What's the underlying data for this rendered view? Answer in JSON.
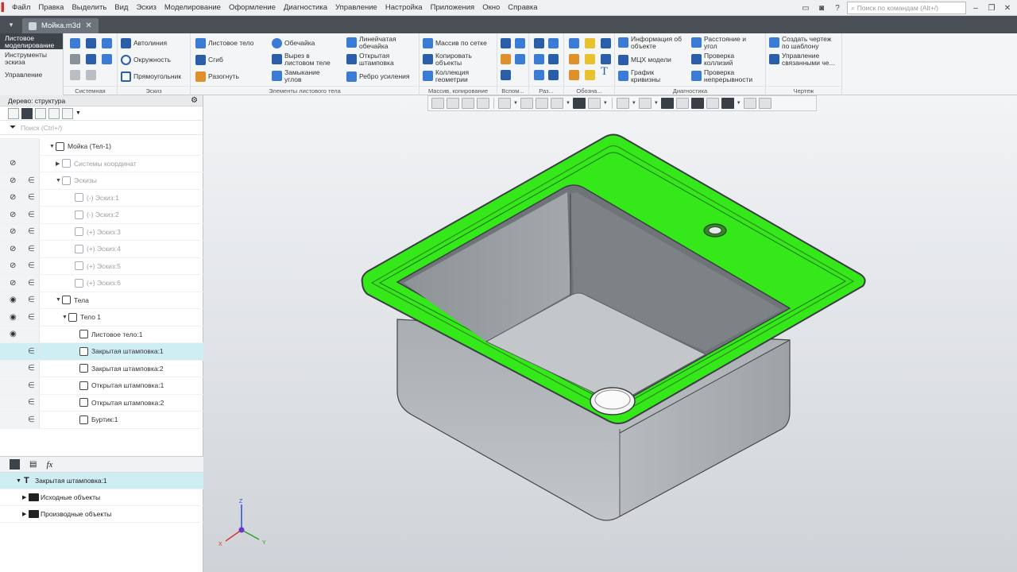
{
  "menu": [
    "Файл",
    "Правка",
    "Выделить",
    "Вид",
    "Эскиз",
    "Моделирование",
    "Оформление",
    "Диагностика",
    "Управление",
    "Настройка",
    "Приложения",
    "Окно",
    "Справка"
  ],
  "search_placeholder": "Поиск по командам (Alt+/)",
  "document_tab": "Мойка.m3d",
  "modes": [
    "Листовое моделирование",
    "Инструменты эскиза",
    "Управление"
  ],
  "ribbon": {
    "sistemnaya": "Системная",
    "eskiz": {
      "title": "Эскиз",
      "buttons": [
        "Автолиния",
        "Окружность",
        "Прямоугольник"
      ]
    },
    "sheet": {
      "title": "Элементы листового тела",
      "buttons": [
        "Листовое тело",
        "Сгиб",
        "Разогнуть",
        "Обечайка",
        "Вырез в листовом теле",
        "Замыкание углов",
        "Линейчатая обечайка",
        "Открытая штамповка",
        "Ребро усиления"
      ]
    },
    "array": {
      "title": "Массив, копирование",
      "buttons": [
        "Массив по сетке",
        "Копировать объекты",
        "Коллекция геометрии"
      ]
    },
    "vspom": "Вспом...",
    "raz": "Раз...",
    "oboz": "Обозна...",
    "diag": {
      "title": "Диагностика",
      "buttons": [
        "Информация об объекте",
        "МЦХ модели",
        "График кривизны",
        "Расстояние и угол",
        "Проверка коллизий",
        "Проверка непрерывности"
      ]
    },
    "drawing": {
      "title": "Чертеж",
      "buttons": [
        "Создать чертеж по шаблону",
        "Управление связанными че..."
      ]
    }
  },
  "tree_panel": {
    "title": "Дерево: структура",
    "search_placeholder": "Поиск (Ctrl+/)",
    "rows": [
      {
        "label": "Мойка (Тел-1)"
      },
      {
        "label": "Системы координат"
      },
      {
        "label": "Эскизы"
      },
      {
        "label": "(-) Эскиз:1"
      },
      {
        "label": "(-) Эскиз:2"
      },
      {
        "label": "(+) Эскиз:3"
      },
      {
        "label": "(+) Эскиз:4"
      },
      {
        "label": "(+) Эскиз:5"
      },
      {
        "label": "(+) Эскиз:6"
      },
      {
        "label": "Тела"
      },
      {
        "label": "Тело 1"
      },
      {
        "label": "Листовое тело:1"
      },
      {
        "label": "Закрытая штамповка:1"
      },
      {
        "label": "Закрытая штамповка:2"
      },
      {
        "label": "Открытая штамповка:1"
      },
      {
        "label": "Открытая штамповка:2"
      },
      {
        "label": "Буртик:1"
      }
    ]
  },
  "relations_panel": {
    "selected": "Закрытая штамповка:1",
    "children": [
      "Исходные объекты",
      "Производные объекты"
    ]
  },
  "axes": {
    "x": "X",
    "y": "Y",
    "z": "Z"
  },
  "colors": {
    "highlight": "#35e81a",
    "selection_row": "#cfeef4",
    "active_mode": "#3d434a"
  }
}
